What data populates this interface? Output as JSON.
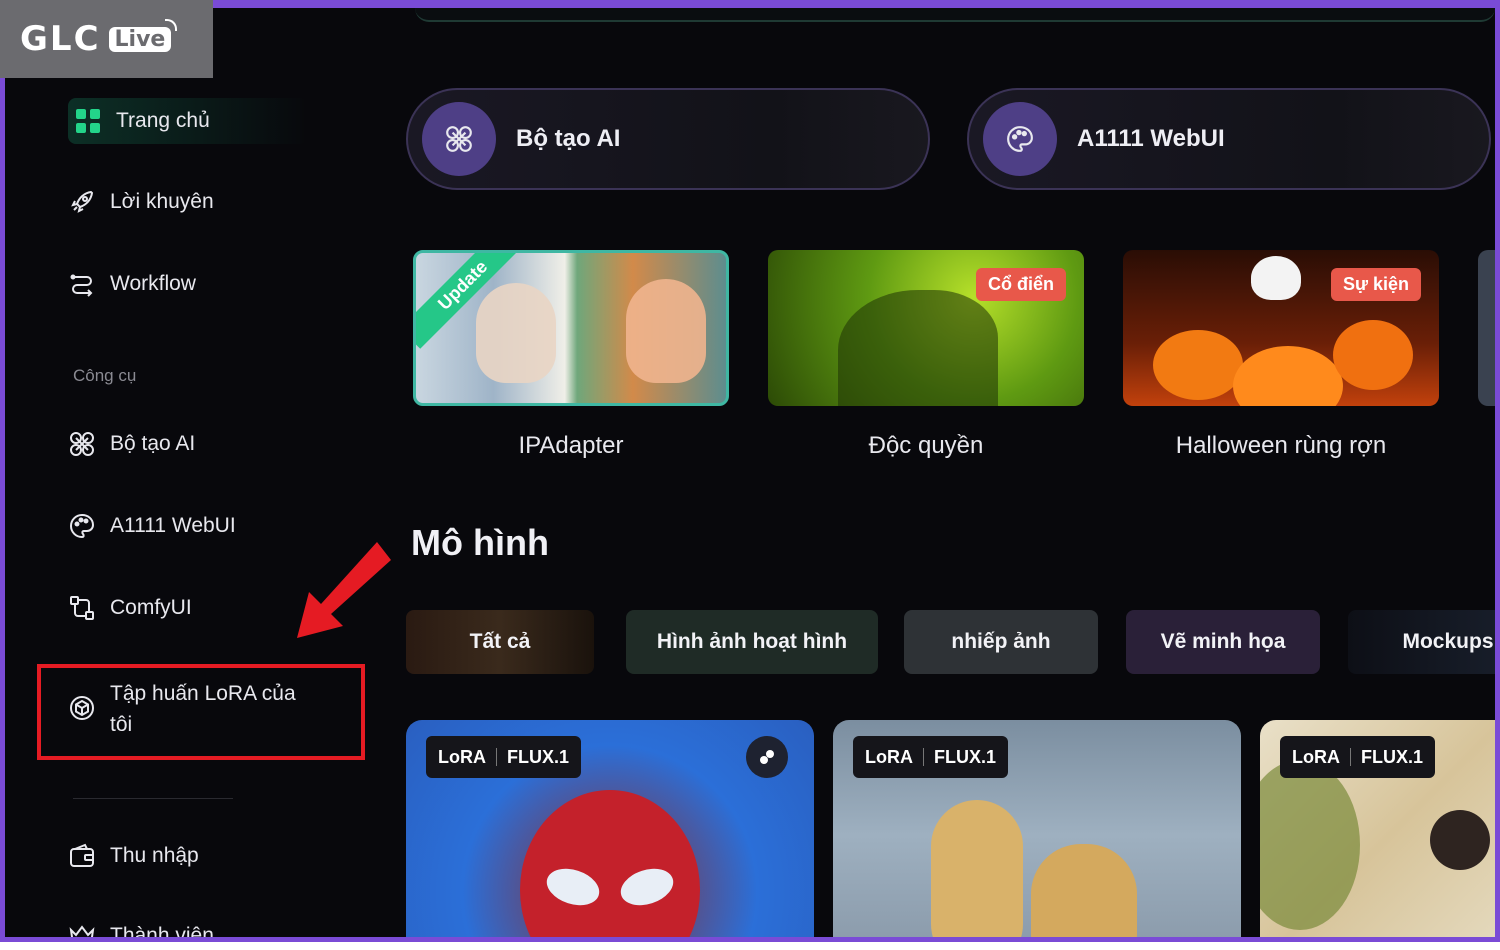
{
  "logo": {
    "brand": "GLC",
    "live": "Live"
  },
  "sidebar": {
    "items": [
      {
        "label": "Trang chủ",
        "icon": "grid-icon"
      },
      {
        "label": "Lời khuyên",
        "icon": "rocket-icon"
      },
      {
        "label": "Workflow",
        "icon": "workflow-icon"
      }
    ],
    "section_tools": "Công cụ",
    "tools": [
      {
        "label": "Bộ tạo AI",
        "icon": "generator-icon"
      },
      {
        "label": "A1111 WebUI",
        "icon": "palette-icon"
      },
      {
        "label": "ComfyUI",
        "icon": "comfyui-icon"
      },
      {
        "label_line1": "Tập huấn LoRA của",
        "label_line2": "tôi",
        "icon": "cube-icon"
      }
    ],
    "bottom": [
      {
        "label": "Thu nhập",
        "icon": "wallet-icon"
      },
      {
        "label": "Thành viên",
        "icon": "crown-icon"
      }
    ]
  },
  "features": [
    {
      "label": "Bộ tạo AI",
      "icon": "generator-icon"
    },
    {
      "label": "A1111 WebUI",
      "icon": "palette-icon"
    }
  ],
  "cards": [
    {
      "title": "IPAdapter",
      "ribbon": "Update"
    },
    {
      "title": "Độc quyền",
      "tag": "Cổ điển"
    },
    {
      "title": "Halloween rùng rợn",
      "tag": "Sự kiện"
    }
  ],
  "models_section": {
    "title": "Mô hình"
  },
  "chips": [
    "Tất cả",
    "Hình ảnh hoạt hình",
    "nhiếp ảnh",
    "Vẽ minh họa",
    "Mockups"
  ],
  "models": [
    {
      "type": "LoRA",
      "base": "FLUX.1"
    },
    {
      "type": "LoRA",
      "base": "FLUX.1"
    },
    {
      "type": "LoRA",
      "base": "FLUX.1"
    }
  ],
  "colors": {
    "accent": "#7a4bd6",
    "highlight": "#e51b23",
    "tag": "#e8584a",
    "ribbon": "#25c788"
  }
}
